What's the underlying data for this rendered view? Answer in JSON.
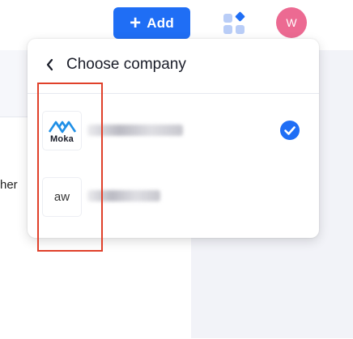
{
  "topbar": {
    "add_label": "Add",
    "avatar_initial": "W",
    "apps_icon": "apps-grid-icon"
  },
  "background": {
    "partial_text": "her"
  },
  "dropdown": {
    "back_icon": "chevron-left-icon",
    "title": "Choose company",
    "companies": [
      {
        "logo_text": "Moka",
        "selected": true
      },
      {
        "logo_text": "aw",
        "selected": false
      }
    ]
  },
  "colors": {
    "primary": "#1f6ef5",
    "avatar": "#ec6a92",
    "annotation": "#e0402a"
  }
}
